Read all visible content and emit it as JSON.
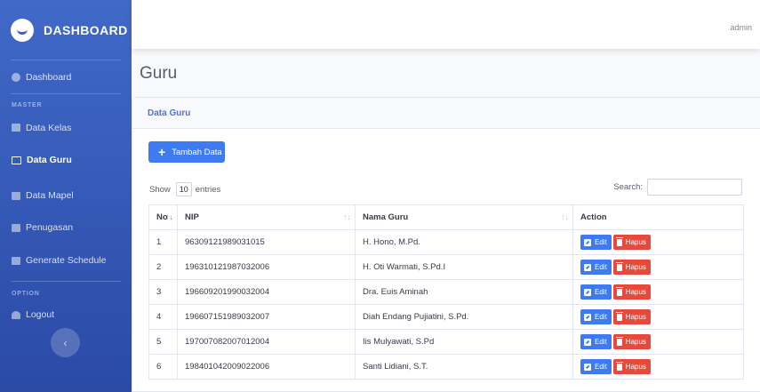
{
  "sidebar": {
    "brand": "DASHBOARD",
    "items": {
      "dashboard": "Dashboard",
      "data_kelas": "Data Kelas",
      "data_guru": "Data Guru",
      "data_mapel": "Data Mapel",
      "penugasan": "Penugasan",
      "generate_schedule": "Generate Schedule",
      "logout": "Logout"
    },
    "headings": {
      "master": "MASTER",
      "option": "OPTION"
    },
    "toggle_icon": "‹"
  },
  "topbar": {
    "user": "admin"
  },
  "page": {
    "title": "Guru"
  },
  "card": {
    "title": "Data Guru"
  },
  "toolbar": {
    "add_label": "Tambah Data",
    "show_label": "Show",
    "entries_value": "10",
    "entries_label": "entries",
    "search_label": "Search:"
  },
  "table": {
    "headers": {
      "no": "No",
      "nip": "NIP",
      "nama": "Nama Guru",
      "action": "Action"
    },
    "edit_label": "Edit",
    "delete_label": "Hapus",
    "rows": [
      {
        "no": "1",
        "nip": "96309121989031015",
        "nama": "H. Hono, M.Pd."
      },
      {
        "no": "2",
        "nip": "196310121987032006",
        "nama": "H. Oti Warmati, S.Pd.I"
      },
      {
        "no": "3",
        "nip": "196609201990032004",
        "nama": "Dra. Euis Aminah"
      },
      {
        "no": "4",
        "nip": "196607151989032007",
        "nama": "Diah Endang Pujiatini, S.Pd."
      },
      {
        "no": "5",
        "nip": "197007082007012004",
        "nama": "Iis Mulyawati, S.Pd"
      },
      {
        "no": "6",
        "nip": "198401042009022006",
        "nama": "Santi Lidiani, S.T."
      }
    ]
  },
  "colors": {
    "sidebar": "#3a5fc0",
    "primary": "#3f7bf0",
    "danger": "#e74a3b"
  }
}
